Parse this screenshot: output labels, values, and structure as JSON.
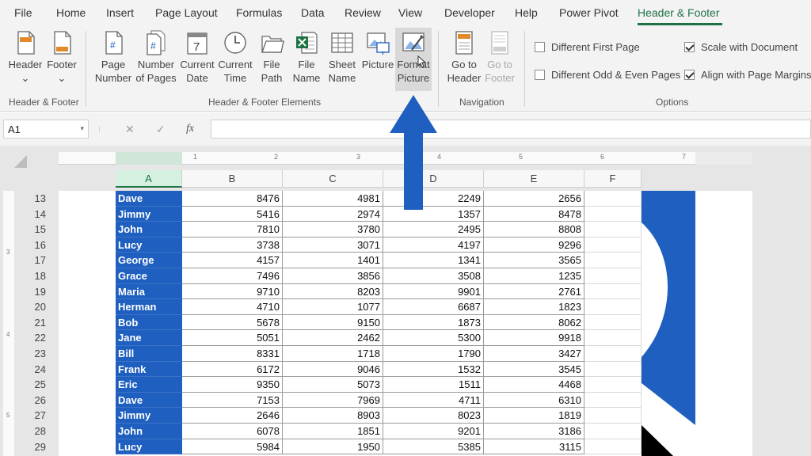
{
  "tabs": [
    "File",
    "Home",
    "Insert",
    "Page Layout",
    "Formulas",
    "Data",
    "Review",
    "View",
    "Developer",
    "Help",
    "Power Pivot",
    "Header & Footer"
  ],
  "active_tab": "Header & Footer",
  "ribbon": {
    "group1": {
      "label": "Header & Footer",
      "buttons": [
        {
          "line1": "Header",
          "line2": "⌄"
        },
        {
          "line1": "Footer",
          "line2": "⌄"
        }
      ]
    },
    "group2": {
      "label": "Header & Footer Elements",
      "buttons": [
        {
          "line1": "Page",
          "line2": "Number",
          "icon": "#"
        },
        {
          "line1": "Number",
          "line2": "of Pages",
          "icon": "#"
        },
        {
          "line1": "Current",
          "line2": "Date",
          "icon": "7"
        },
        {
          "line1": "Current",
          "line2": "Time"
        },
        {
          "line1": "File",
          "line2": "Path"
        },
        {
          "line1": "File",
          "line2": "Name"
        },
        {
          "line1": "Sheet",
          "line2": "Name"
        },
        {
          "line1": "Picture",
          "line2": ""
        },
        {
          "line1": "Format",
          "line2": "Picture"
        }
      ]
    },
    "group3": {
      "label": "Navigation",
      "buttons": [
        {
          "line1": "Go to",
          "line2": "Header"
        },
        {
          "line1": "Go to",
          "line2": "Footer"
        }
      ]
    },
    "group4": {
      "label": "Options",
      "options": [
        {
          "label": "Different First Page",
          "checked": false
        },
        {
          "label": "Different Odd & Even Pages",
          "checked": false
        },
        {
          "label": "Scale with Document",
          "checked": true
        },
        {
          "label": "Align with Page Margins",
          "checked": true
        }
      ]
    }
  },
  "formula_bar": {
    "name_box": "A1",
    "cancel": "✕",
    "enter": "✓",
    "fx": "fx",
    "value": ""
  },
  "ruler_numbers": [
    "1",
    "2",
    "3",
    "4",
    "5",
    "6",
    "7"
  ],
  "vruler_numbers": [
    "3",
    "4",
    "5"
  ],
  "columns": [
    "A",
    "B",
    "C",
    "D",
    "E",
    "F"
  ],
  "rows": [
    {
      "num": "13",
      "name": "Dave",
      "b": "8476",
      "c": "4981",
      "d": "2249",
      "e": "2656"
    },
    {
      "num": "14",
      "name": "Jimmy",
      "b": "5416",
      "c": "2974",
      "d": "1357",
      "e": "8478"
    },
    {
      "num": "15",
      "name": "John",
      "b": "7810",
      "c": "3780",
      "d": "2495",
      "e": "8808"
    },
    {
      "num": "16",
      "name": "Lucy",
      "b": "3738",
      "c": "3071",
      "d": "4197",
      "e": "9296"
    },
    {
      "num": "17",
      "name": "George",
      "b": "4157",
      "c": "1401",
      "d": "1341",
      "e": "3565"
    },
    {
      "num": "18",
      "name": "Grace",
      "b": "7496",
      "c": "3856",
      "d": "3508",
      "e": "1235"
    },
    {
      "num": "19",
      "name": "Maria",
      "b": "9710",
      "c": "8203",
      "d": "9901",
      "e": "2761"
    },
    {
      "num": "20",
      "name": "Herman",
      "b": "4710",
      "c": "1077",
      "d": "6687",
      "e": "1823"
    },
    {
      "num": "21",
      "name": "Bob",
      "b": "5678",
      "c": "9150",
      "d": "1873",
      "e": "8062"
    },
    {
      "num": "22",
      "name": "Jane",
      "b": "5051",
      "c": "2462",
      "d": "5300",
      "e": "9918"
    },
    {
      "num": "23",
      "name": "Bill",
      "b": "8331",
      "c": "1718",
      "d": "1790",
      "e": "3427"
    },
    {
      "num": "24",
      "name": "Frank",
      "b": "6172",
      "c": "9046",
      "d": "1532",
      "e": "3545"
    },
    {
      "num": "25",
      "name": "Eric",
      "b": "9350",
      "c": "5073",
      "d": "1511",
      "e": "4468"
    },
    {
      "num": "26",
      "name": "Dave",
      "b": "7153",
      "c": "7969",
      "d": "4711",
      "e": "6310"
    },
    {
      "num": "27",
      "name": "Jimmy",
      "b": "2646",
      "c": "8903",
      "d": "8023",
      "e": "1819"
    },
    {
      "num": "28",
      "name": "John",
      "b": "6078",
      "c": "1851",
      "d": "9201",
      "e": "3186"
    },
    {
      "num": "29",
      "name": "Lucy",
      "b": "5984",
      "c": "1950",
      "d": "5385",
      "e": "3115"
    }
  ],
  "colors": {
    "accent": "#1e7145",
    "name_fill": "#1f5fbf",
    "arrow": "#1f5fbf",
    "watermark": "#1f5fbf"
  }
}
